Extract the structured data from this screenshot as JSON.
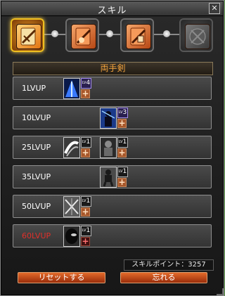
{
  "window": {
    "title": "スキル",
    "close_label": "✕"
  },
  "tabs": [
    {
      "name": "tab-two-handed-sword",
      "state": "active"
    },
    {
      "name": "tab-skill-2",
      "state": "inactive"
    },
    {
      "name": "tab-skill-3",
      "state": "inactive"
    },
    {
      "name": "tab-skill-4",
      "state": "locked"
    }
  ],
  "weapon_type": "両手剣",
  "rows": [
    {
      "level": "1LVUP",
      "skills": [
        {
          "lv": "4",
          "icon": "blue-sword-slash-icon"
        }
      ]
    },
    {
      "level": "10LVUP",
      "skills": [
        {
          "lv": "3",
          "icon": "blue-knight-icon"
        }
      ]
    },
    {
      "level": "25LVUP",
      "skills": [
        {
          "lv": "1",
          "icon": "white-slash-icon"
        },
        {
          "lv": "1",
          "icon": "dark-figure-icon"
        }
      ]
    },
    {
      "level": "35LVUP",
      "skills": [
        {
          "lv": "1",
          "icon": "gray-warrior-icon"
        }
      ]
    },
    {
      "level": "50LVUP",
      "skills": [
        {
          "lv": "1",
          "icon": "lightning-cross-icon"
        }
      ]
    },
    {
      "level": "60LVUP",
      "skills": [
        {
          "lv": "1",
          "icon": "dark-mask-icon"
        }
      ]
    }
  ],
  "lv_prefix": "LV",
  "plus_label": "+",
  "skill_points": "スキルポイント：3257",
  "buttons": {
    "reset": "リセットする",
    "forget": "忘れる"
  },
  "colors": {
    "accent": "#f3a33c",
    "locked_level": "#e0302a",
    "button": "#d4501c"
  }
}
